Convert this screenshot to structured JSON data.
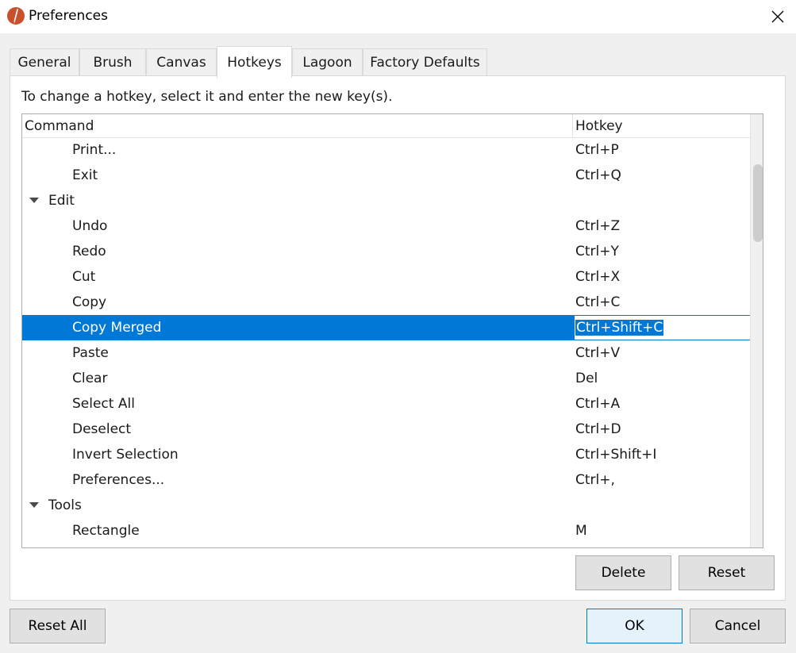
{
  "window": {
    "title": "Preferences"
  },
  "tabs": [
    {
      "label": "General",
      "active": false
    },
    {
      "label": "Brush",
      "active": false
    },
    {
      "label": "Canvas",
      "active": false
    },
    {
      "label": "Hotkeys",
      "active": true
    },
    {
      "label": "Lagoon",
      "active": false
    },
    {
      "label": "Factory Defaults",
      "active": false
    }
  ],
  "hotkeys": {
    "instructions": "To change a hotkey, select it and enter the new key(s).",
    "columns": {
      "command": "Command",
      "hotkey": "Hotkey"
    },
    "rows": [
      {
        "type": "command",
        "command": "Print...",
        "hotkey": "Ctrl+P"
      },
      {
        "type": "command",
        "command": "Exit",
        "hotkey": "Ctrl+Q"
      },
      {
        "type": "group",
        "command": "Edit",
        "hotkey": "",
        "expanded": true
      },
      {
        "type": "command",
        "command": "Undo",
        "hotkey": "Ctrl+Z"
      },
      {
        "type": "command",
        "command": "Redo",
        "hotkey": "Ctrl+Y"
      },
      {
        "type": "command",
        "command": "Cut",
        "hotkey": "Ctrl+X"
      },
      {
        "type": "command",
        "command": "Copy",
        "hotkey": "Ctrl+C"
      },
      {
        "type": "command",
        "command": "Copy Merged",
        "hotkey": "Ctrl+Shift+C",
        "selected": true,
        "editing": true
      },
      {
        "type": "command",
        "command": "Paste",
        "hotkey": "Ctrl+V"
      },
      {
        "type": "command",
        "command": "Clear",
        "hotkey": "Del"
      },
      {
        "type": "command",
        "command": "Select All",
        "hotkey": "Ctrl+A"
      },
      {
        "type": "command",
        "command": "Deselect",
        "hotkey": "Ctrl+D"
      },
      {
        "type": "command",
        "command": "Invert Selection",
        "hotkey": "Ctrl+Shift+I"
      },
      {
        "type": "command",
        "command": "Preferences...",
        "hotkey": "Ctrl+,"
      },
      {
        "type": "group",
        "command": "Tools",
        "hotkey": "",
        "expanded": true
      },
      {
        "type": "command",
        "command": "Rectangle",
        "hotkey": "M"
      }
    ],
    "delete_label": "Delete",
    "reset_label": "Reset"
  },
  "footer": {
    "reset_all_label": "Reset All",
    "ok_label": "OK",
    "cancel_label": "Cancel"
  },
  "colors": {
    "selection": "#0078d7",
    "window_bg": "#f0f0f0",
    "panel_bg": "#ffffff"
  },
  "icons": {
    "app": "brush-app-icon",
    "close": "close-icon",
    "expander": "triangle-down-icon"
  }
}
